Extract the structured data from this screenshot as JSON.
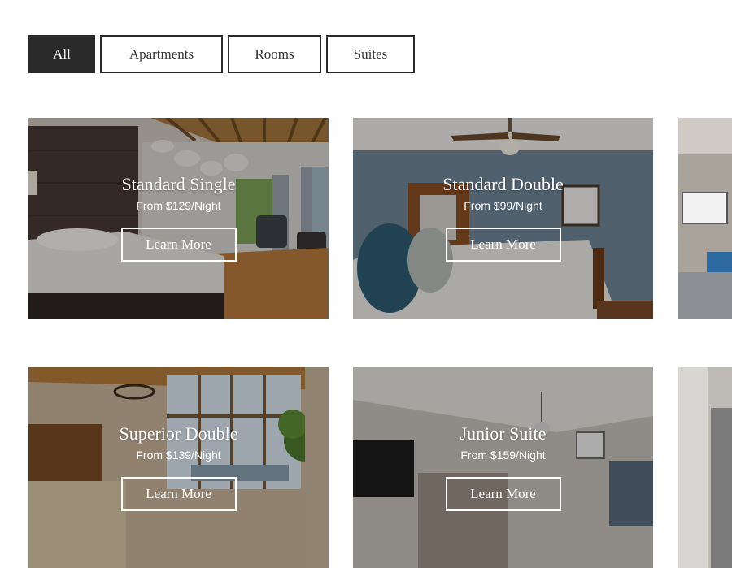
{
  "filters": {
    "all": "All",
    "apartments": "Apartments",
    "rooms": "Rooms",
    "suites": "Suites"
  },
  "cards": [
    {
      "title": "Standard Single",
      "price": "From $129/Night",
      "cta": "Learn More"
    },
    {
      "title": "Standard Double",
      "price": "From $99/Night",
      "cta": "Learn More"
    },
    {
      "title": "Superior Double",
      "price": "From $139/Night",
      "cta": "Learn More"
    },
    {
      "title": "Junior Suite",
      "price": "From $159/Night",
      "cta": "Learn More"
    }
  ],
  "colors": {
    "active_filter_bg": "#2a2a2a",
    "border": "#2a2a2a",
    "card_text": "#ffffff"
  }
}
